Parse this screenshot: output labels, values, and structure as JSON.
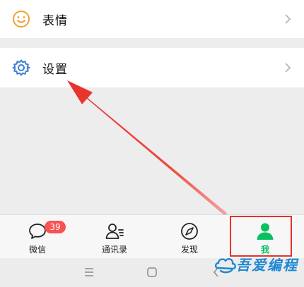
{
  "menu": {
    "emoji_label": "表情",
    "settings_label": "设置"
  },
  "tabs": [
    {
      "label": "微信",
      "badge": "39"
    },
    {
      "label": "通讯录"
    },
    {
      "label": "发现"
    },
    {
      "label": "我"
    }
  ],
  "watermark": {
    "text": "吾爱编程"
  },
  "colors": {
    "accent_green": "#07c160",
    "badge_red": "#fa5151",
    "annotation_red": "#e8312b",
    "settings_blue": "#3a7fd5",
    "emoji_orange": "#f0a030"
  },
  "icons": {
    "emoji_row": "smile-face-icon",
    "settings_row": "gear-icon",
    "tab_chats": "chat-bubble-icon",
    "tab_contacts": "contacts-icon",
    "tab_discover": "compass-icon",
    "tab_me": "person-icon"
  }
}
